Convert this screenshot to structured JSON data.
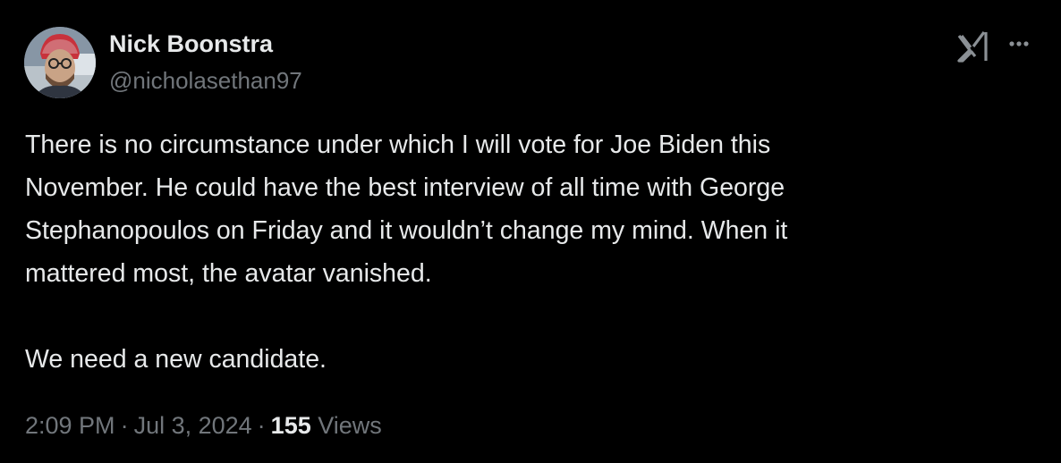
{
  "author": {
    "display_name": "Nick Boonstra",
    "handle": "@nicholasethan97"
  },
  "icons": {
    "avatar": "avatar-photo",
    "logo": "x-grok-logo-icon",
    "more": "more-horizontal-icon"
  },
  "tweet": {
    "lines": [
      "There is no circumstance under which I will vote for Joe Biden this",
      "November. He could have the best interview of all time with George",
      "Stephanopoulos on Friday and it wouldn’t change my mind. When it",
      "mattered most, the avatar vanished."
    ],
    "closing_line": "We need a new candidate."
  },
  "meta": {
    "time": "2:09 PM",
    "separator": "·",
    "date": "Jul 3, 2024",
    "views_count": "155",
    "views_label": "Views"
  },
  "colors": {
    "background": "#000000",
    "primary_text": "#e7e9ea",
    "secondary_text": "#71767b"
  }
}
